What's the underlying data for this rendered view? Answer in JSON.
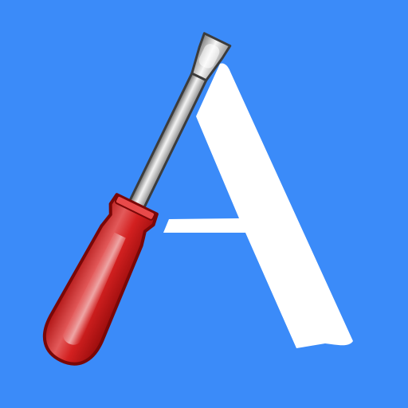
{
  "app_icon": {
    "background_color": "#3b8bf9",
    "letter_color": "#ffffff",
    "icons": [
      "letter-a-icon",
      "screwdriver-icon"
    ],
    "handle_colors": {
      "dark": "#8e0a0a",
      "mid": "#d32020",
      "light": "#f57a7a"
    },
    "shaft_colors": {
      "dark": "#5d5d5d",
      "light": "#f1f1f1"
    }
  }
}
